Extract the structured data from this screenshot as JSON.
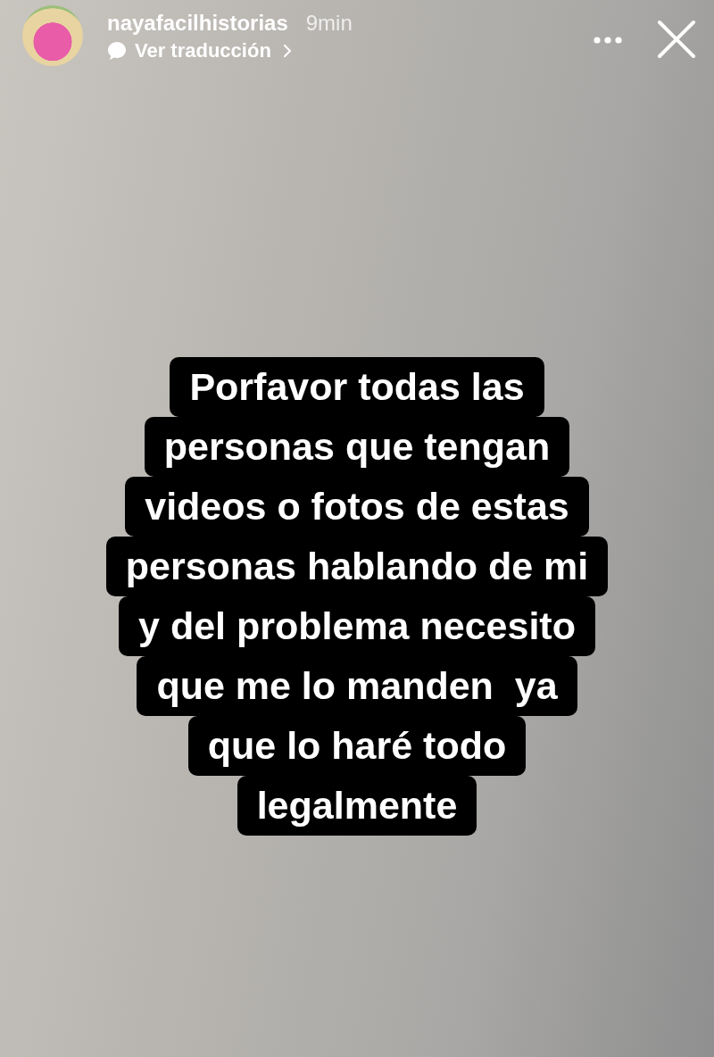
{
  "story_header": {
    "username": "nayafacilhistorias",
    "time": "9min",
    "translate_link": "Ver traducción"
  },
  "caption_lines": [
    "Porfavor todas las",
    "personas que tengan",
    "videos o fotos de estas",
    "personas hablando de mi",
    "y del problema necesito",
    "que me lo manden  ya",
    "que lo haré todo",
    "legalmente"
  ]
}
